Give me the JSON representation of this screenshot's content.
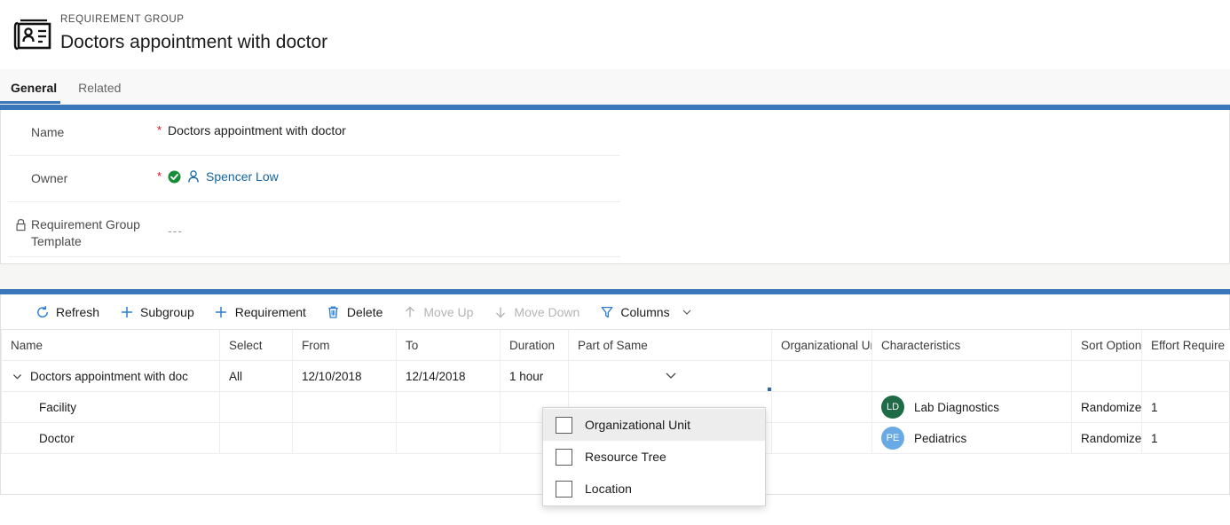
{
  "header": {
    "entity_type": "REQUIREMENT GROUP",
    "record_title": "Doctors appointment with doctor",
    "icon": "contact-card-icon"
  },
  "tabs": [
    {
      "label": "General",
      "active": true
    },
    {
      "label": "Related",
      "active": false
    }
  ],
  "form": {
    "rows": [
      {
        "label": "Name",
        "required": "*",
        "value": "Doctors appointment with doctor",
        "locked": false,
        "type": "text"
      },
      {
        "label": "Owner",
        "required": "*",
        "value": "Spencer Low",
        "locked": false,
        "type": "lookup",
        "status_icon": "green-check-icon",
        "person_icon": "person-icon"
      },
      {
        "label": "Requirement Group Template",
        "required": "",
        "value": "---",
        "locked": true,
        "lock_icon": "lock-icon",
        "type": "text"
      }
    ]
  },
  "toolbar": {
    "commands": [
      {
        "label": "Refresh",
        "icon": "refresh-icon",
        "disabled": false
      },
      {
        "label": "Subgroup",
        "icon": "plus-icon",
        "disabled": false
      },
      {
        "label": "Requirement",
        "icon": "plus-icon",
        "disabled": false
      },
      {
        "label": "Delete",
        "icon": "trash-icon",
        "disabled": false
      },
      {
        "label": "Move Up",
        "icon": "arrow-up-icon",
        "disabled": true
      },
      {
        "label": "Move Down",
        "icon": "arrow-down-icon",
        "disabled": true
      },
      {
        "label": "Columns",
        "icon": "filter-icon",
        "disabled": false,
        "caret": true
      }
    ]
  },
  "grid": {
    "columns": [
      "Name",
      "Select",
      "From",
      "To",
      "Duration",
      "Part of Same",
      "Organizational Unit",
      "Characteristics",
      "Sort Option",
      "Effort Require"
    ],
    "rows": [
      {
        "name": "Doctors appointment with doc",
        "expandable": true,
        "expanded": true,
        "indent": false,
        "select": "All",
        "from": "12/10/2018",
        "to": "12/14/2018",
        "duration": "1 hour",
        "part_of_same": "",
        "part_of_same_selected": true,
        "organizational_unit": "",
        "characteristic": "",
        "characteristic_initials": "",
        "characteristic_color": "",
        "sort_option": "",
        "effort_required": ""
      },
      {
        "name": "Facility",
        "expandable": false,
        "expanded": false,
        "indent": true,
        "select": "",
        "from": "",
        "to": "",
        "duration": "",
        "part_of_same": "",
        "part_of_same_selected": false,
        "organizational_unit": "",
        "characteristic": "Lab Diagnostics",
        "characteristic_initials": "LD",
        "characteristic_color": "#1e6b45",
        "sort_option": "Randomize",
        "effort_required": "1"
      },
      {
        "name": "Doctor",
        "expandable": false,
        "expanded": false,
        "indent": true,
        "select": "",
        "from": "",
        "to": "",
        "duration": "",
        "part_of_same": "",
        "part_of_same_selected": false,
        "organizational_unit": "",
        "characteristic": "Pediatrics",
        "characteristic_initials": "PE",
        "characteristic_color": "#6aaae4",
        "sort_option": "Randomize",
        "effort_required": "1"
      }
    ]
  },
  "dropdown": {
    "open": true,
    "options": [
      {
        "label": "Organizational Unit",
        "checked": false,
        "hovered": true
      },
      {
        "label": "Resource Tree",
        "checked": false,
        "hovered": false
      },
      {
        "label": "Location",
        "checked": false,
        "hovered": false
      }
    ]
  },
  "colors": {
    "accent": "#3a76ba",
    "selection_border": "#2b6cb0",
    "link": "#1264a3",
    "required": "#e00b1c",
    "icon_blue": "#2b7cd3",
    "success_green": "#178d3a"
  }
}
